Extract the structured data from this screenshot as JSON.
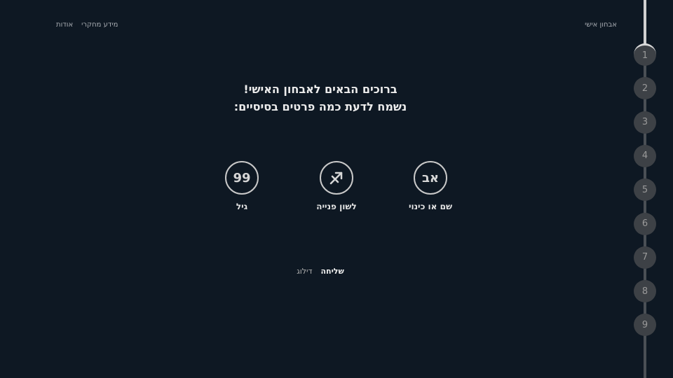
{
  "nav": {
    "about": "אודות",
    "research": "מידע מחקרי",
    "brand": "אבחון אישי"
  },
  "welcome": {
    "line1": "ברוכים הבאים לאבחון האישי!",
    "line2": "נשמח לדעת כמה פרטים בסיסיים:"
  },
  "fields": {
    "name": {
      "icon_text": "אב",
      "label": "שם או כינוי"
    },
    "pronoun": {
      "icon": "gender-symbol-icon",
      "label": "לשון פנייה"
    },
    "age": {
      "icon_text": "99",
      "label": "גיל"
    }
  },
  "actions": {
    "send": "שליחה",
    "skip": "דילוג"
  },
  "progress": {
    "current_step": 1,
    "fill_fraction": 0.12,
    "steps": [
      "1",
      "2",
      "3",
      "4",
      "5",
      "6",
      "7",
      "8",
      "9"
    ]
  },
  "colors": {
    "background": "#0e1823",
    "text": "#e6e6e6",
    "step_circle": "#3d4146"
  }
}
